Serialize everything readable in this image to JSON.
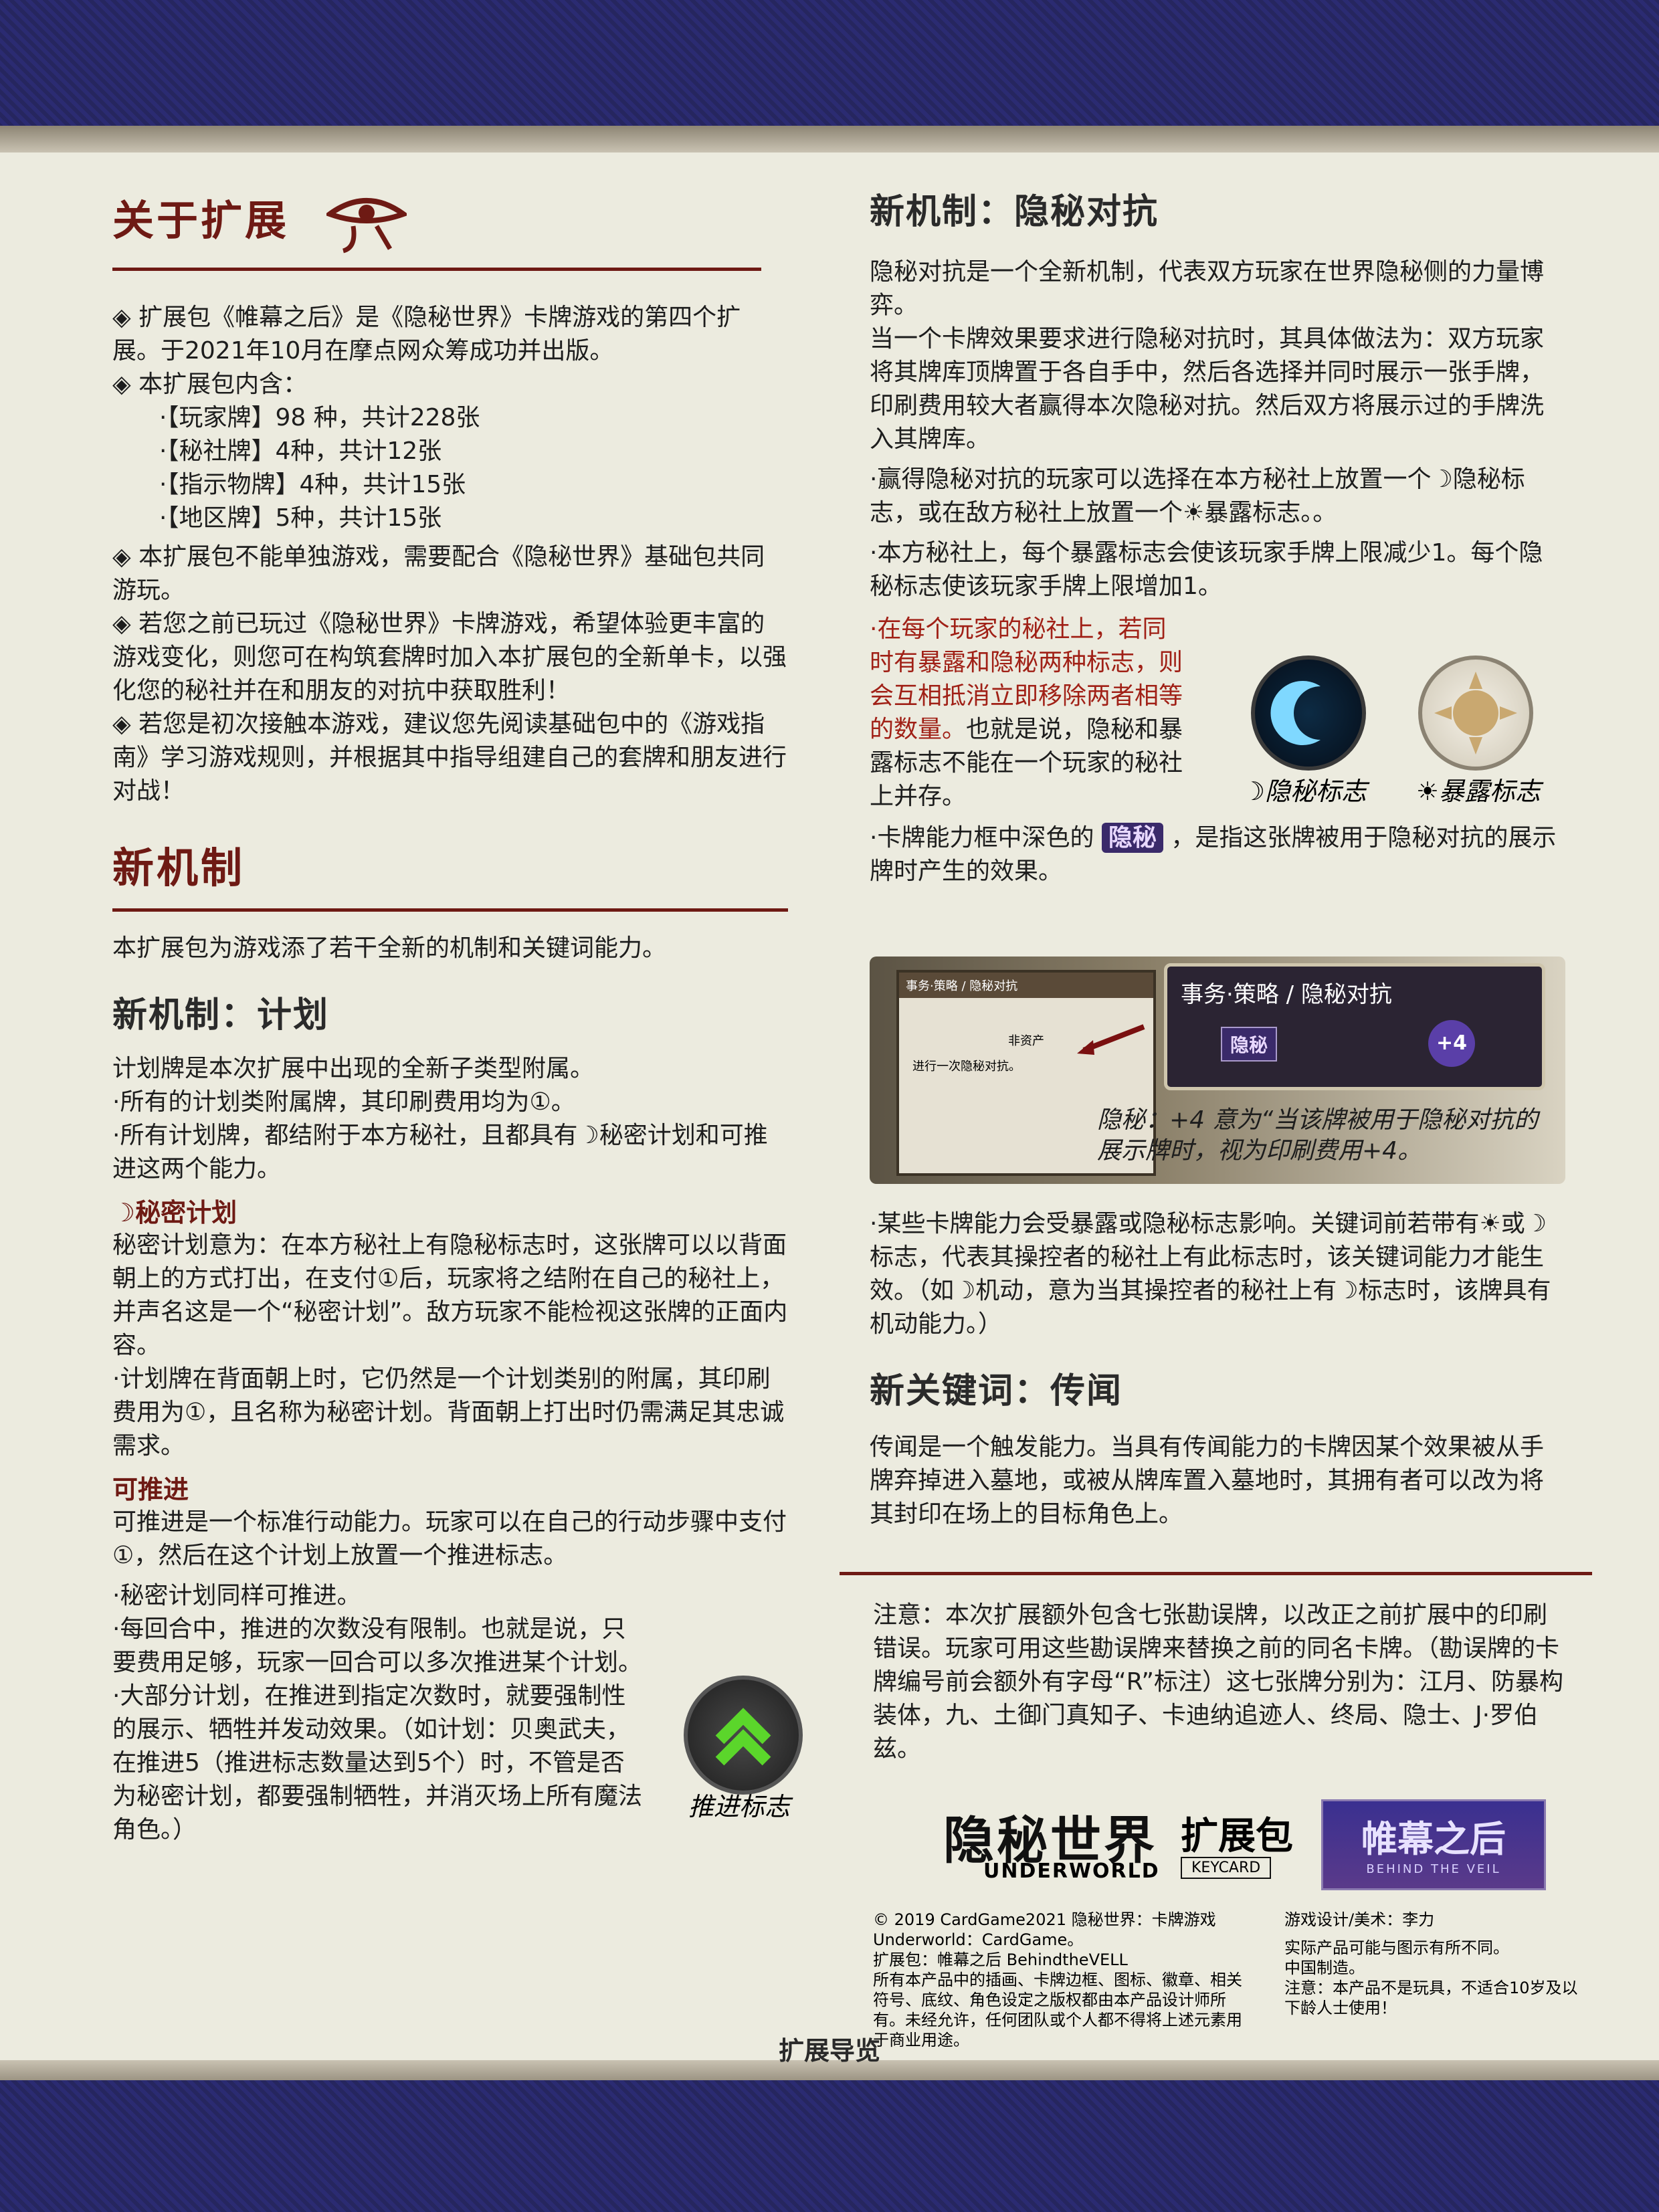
{
  "left": {
    "about": {
      "title": "关于扩展",
      "p1": "◈ 扩展包《帷幕之后》是《隐秘世界》卡牌游戏的第四个扩展。于2021年10月在摩点网众筹成功并出版。",
      "p2": "◈ 本扩展包内含：",
      "contents": [
        "·【玩家牌】98 种，共计228张",
        "·【秘社牌】4种，共计12张",
        "·【指示物牌】4种，共计15张",
        "·【地区牌】5种，共计15张"
      ],
      "p3": "◈ 本扩展包不能单独游戏，需要配合《隐秘世界》基础包共同游玩。",
      "p4": "◈ 若您之前已玩过《隐秘世界》卡牌游戏，希望体验更丰富的游戏变化，则您可在构筑套牌时加入本扩展包的全新单卡，以强化您的秘社并在和朋友的对抗中获取胜利！",
      "p5": "◈ 若您是初次接触本游戏，建议您先阅读基础包中的《游戏指南》学习游戏规则，并根据其中指导组建自己的套牌和朋友进行对战！"
    },
    "mech": {
      "title": "新机制",
      "intro": "本扩展包为游戏添了若干全新的机制和关键词能力。",
      "plan_title": "新机制：计划",
      "plan_p1": "计划牌是本次扩展中出现的全新子类型附属。",
      "plan_p2": "·所有的计划类附属牌，其印刷费用均为①。",
      "plan_p3": "·所有计划牌，都结附于本方秘社，且都具有☽秘密计划和可推进这两个能力。",
      "secret_title": "☽秘密计划",
      "secret_p1": "秘密计划意为：在本方秘社上有隐秘标志时，这张牌可以以背面朝上的方式打出，在支付①后，玩家将之结附在自己的秘社上，并声名这是一个“秘密计划”。敌方玩家不能检视这张牌的正面内容。",
      "secret_p2": "·计划牌在背面朝上时，它仍然是一个计划类别的附属，其印刷费用为①，且名称为秘密计划。背面朝上打出时仍需满足其忠诚需求。",
      "adv_title": "可推进",
      "adv_p1": "可推进是一个标准行动能力。玩家可以在自己的行动步骤中支付①，然后在这个计划上放置一个推进标志。",
      "adv_p2": "·秘密计划同样可推进。",
      "adv_p3": "·每回合中，推进的次数没有限制。也就是说，只要费用足够，玩家一回合可以多次推进某个计划。",
      "adv_p4": "·大部分计划，在推进到指定次数时，就要强制性的展示、牺牲并发动效果。（如计划：贝奥武夫，在推进5（推进标志数量达到5个）时，不管是否为秘密计划，都要强制牺牲，并消灭场上所有魔法角色。）",
      "adv_token_label": "推进标志"
    }
  },
  "right": {
    "occult": {
      "title": "新机制：隐秘对抗",
      "p1": "隐秘对抗是一个全新机制，代表双方玩家在世界隐秘侧的力量博弈。",
      "p2": "当一个卡牌效果要求进行隐秘对抗时，其具体做法为：双方玩家将其牌库顶牌置于各自手中，然后各选择并同时展示一张手牌，印刷费用较大者赢得本次隐秘对抗。然后双方将展示过的手牌洗入其牌库。",
      "p3": "·赢得隐秘对抗的玩家可以选择在本方秘社上放置一个☽隐秘标志，或在敌方秘社上放置一个☀暴露标志。。",
      "p4": "·本方秘社上，每个暴露标志会使该玩家手牌上限减少1。每个隐秘标志使该玩家手牌上限增加1。",
      "p5_red": "·在每个玩家的秘社上，若同时有暴露和隐秘两种标志，则会互相抵消立即移除两者相等的数量。",
      "p5_rest": "也就是说，隐秘和暴露标志不能在一个玩家的秘社上并存。",
      "hidden_label": "☽隐秘标志",
      "exposed_label": "☀暴露标志",
      "p6a": "·卡牌能力框中深色的",
      "p6_badge": "隐秘",
      "p6b": "，是指这张牌被用于隐秘对抗的展示牌时产生的效果。",
      "card_head": "事务·策略 / 隐秘对抗",
      "card_badge": "隐秘",
      "card_plus": "+4",
      "card_small_head": "事务·策略 / 隐秘对抗",
      "card_small_type": "非资产",
      "card_small_text": "进行一次隐秘对抗。",
      "card_caption": "隐秘：+4 意为“当该牌被用于隐秘对抗的展示牌时，视为印刷费用+4。",
      "p7": "·某些卡牌能力会受暴露或隐秘标志影响。关键词前若带有☀或☽ 标志，代表其操控者的秘社上有此标志时，该关键词能力才能生效。（如☽机动，意为当其操控者的秘社上有☽标志时，该牌具有机动能力。）"
    },
    "rumor": {
      "title": "新关键词：传闻",
      "p1": "传闻是一个触发能力。当具有传闻能力的卡牌因某个效果被从手牌弃掉进入墓地，或被从牌库置入墓地时，其拥有者可以改为将其封印在场上的目标角色上。"
    },
    "note": "注意：本次扩展额外包含七张勘误牌，以改正之前扩展中的印刷错误。玩家可用这些勘误牌来替换之前的同名卡牌。（勘误牌的卡牌编号前会额外有字母“R”标注）这七张牌分别为：江月、防暴构装体，九、土御门真知子、卡迪纳追迹人、终局、隐士、J·罗伯兹。",
    "logos": {
      "main": "隐秘世界",
      "main_sub": "UNDERWORLD",
      "exp": "扩展包",
      "exp_sub": "KEYCARD",
      "veil": "帷幕之后",
      "veil_sub": "BEHIND THE VEIL"
    },
    "legal": {
      "left_l1": "© 2019 CardGame2021 隐秘世界：卡牌游戏",
      "left_l2": "Underworld：CardGame。",
      "left_l3": "扩展包：帷幕之后 BehindtheVELL",
      "left_l4": "所有本产品中的插画、卡牌边框、图标、徽章、相关符号、底纹、角色设定之版权都由本产品设计师所有。未经允许，任何团队或个人都不得将上述元素用于商业用途。",
      "right_l1": "游戏设计/美术：李力",
      "right_l2": "实际产品可能与图示有所不同。",
      "right_l3": "中国制造。",
      "right_l4": "注意：本产品不是玩具，不适合10岁及以下龄人士使用！"
    }
  },
  "footer": "扩展导览"
}
